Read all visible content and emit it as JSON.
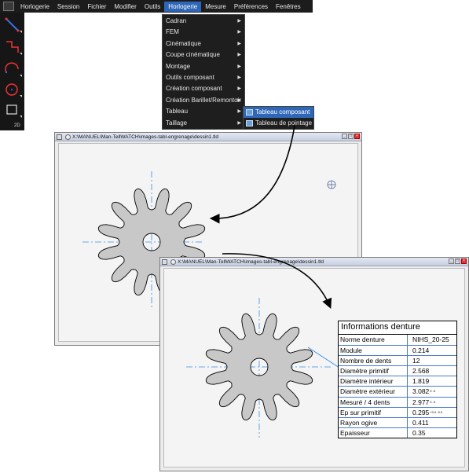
{
  "menubar": {
    "items": [
      "Horlogerie",
      "Session",
      "Fichier",
      "Modifier",
      "Outils",
      "Horlogerie",
      "Mesure",
      "Préférences",
      "Fenêtres"
    ],
    "active_index": 5,
    "active_color": "#2f67b8"
  },
  "toolbar": {
    "label_2d": "2D"
  },
  "dropdown": {
    "items": [
      {
        "label": "Cadran",
        "arrow": true
      },
      {
        "label": "FEM",
        "arrow": true
      },
      {
        "label": "Cinématique",
        "arrow": true
      },
      {
        "label": "Coupe cinématique",
        "arrow": true
      },
      {
        "label": "Montage",
        "arrow": true
      },
      {
        "label": "Outils composant",
        "arrow": true
      },
      {
        "label": "Création composant",
        "arrow": true
      },
      {
        "label": "Création Barillet/Remontoir",
        "arrow": true
      },
      {
        "label": "Tableau",
        "arrow": true
      },
      {
        "label": "Taillage",
        "arrow": true
      }
    ]
  },
  "submenu": {
    "items": [
      {
        "label": "Tableau composant",
        "highlighted": true
      },
      {
        "label": "Tableau de pointage",
        "highlighted": false
      }
    ]
  },
  "window1": {
    "title": "X:\\MANUEL\\Man-TellWATCH\\images-tabl-engrenage\\dessin1.tld"
  },
  "window2": {
    "title": "X:\\MANUEL\\Man-TellWATCH\\images-tabl-engrenage\\dessin1.tld"
  },
  "gear": {
    "teeth": 12,
    "fill": "#c8c8c8",
    "axis_color": "#3a8ee6"
  },
  "info_table": {
    "title": "Informations  denture",
    "rows": [
      {
        "label": "Norme denture",
        "value": "NIHS_20-25",
        "tol": ""
      },
      {
        "label": "Module",
        "value": "0.214",
        "tol": ""
      },
      {
        "label": "Nombre de dents",
        "value": "12",
        "tol": ""
      },
      {
        "label": "Diamètre  primitif",
        "value": "2.568",
        "tol": ""
      },
      {
        "label": "Diamètre intérieur",
        "value": "1.819",
        "tol": ""
      },
      {
        "label": "Diamètre extérieur",
        "value": "3.082",
        "tol": "0\n-0"
      },
      {
        "label": "Mesuré / 4 dents",
        "value": "2.977",
        "tol": "0\n-0"
      },
      {
        "label": "Ep sur primitif",
        "value": "0.295",
        "tol": "+0.0\n-0.0"
      },
      {
        "label": "Rayon ogive",
        "value": "0.411",
        "tol": ""
      },
      {
        "label": "Epaisseur",
        "value": "0.35",
        "tol": ""
      }
    ]
  }
}
